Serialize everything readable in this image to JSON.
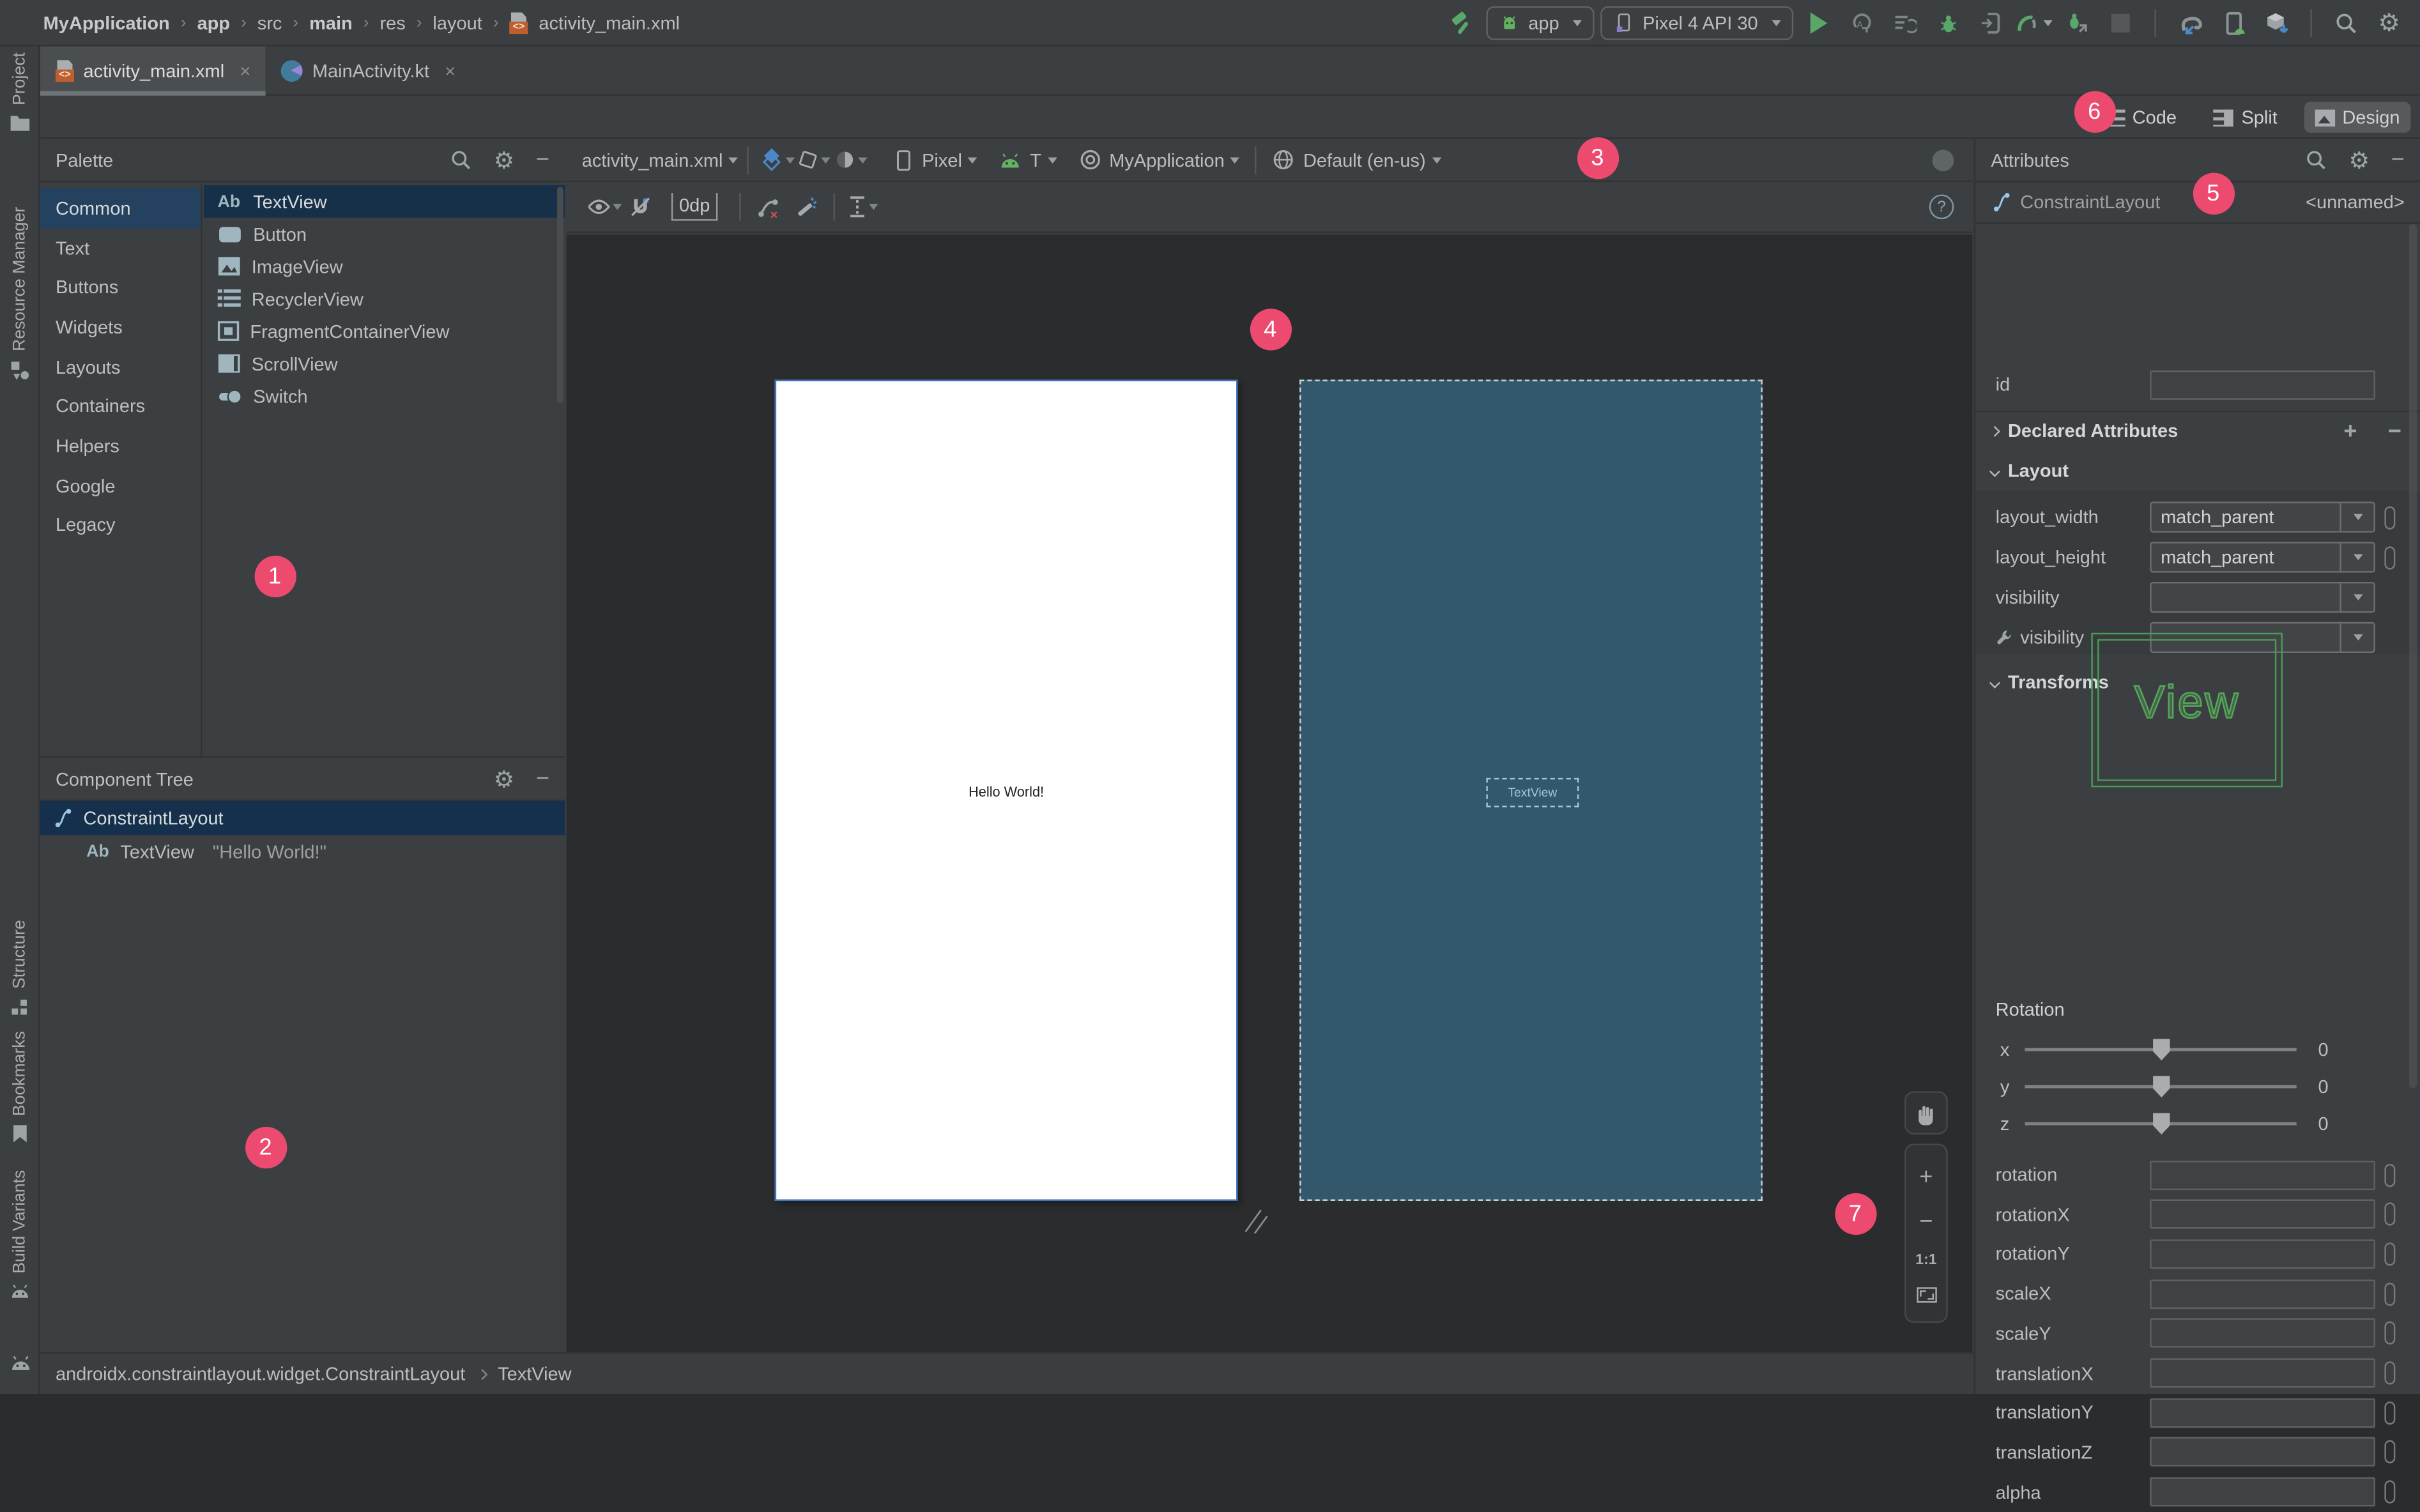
{
  "main_toolbar": {
    "breadcrumb": [
      {
        "label": "MyApplication",
        "bold": true
      },
      {
        "label": "app",
        "bold": true
      },
      {
        "label": "src",
        "bold": false
      },
      {
        "label": "main",
        "bold": true
      },
      {
        "label": "res",
        "bold": false
      },
      {
        "label": "layout",
        "bold": false
      },
      {
        "label": "activity_main.xml",
        "bold": false
      }
    ],
    "run_config": "app",
    "device": "Pixel 4 API 30"
  },
  "tabs": [
    {
      "label": "activity_main.xml",
      "active": true
    },
    {
      "label": "MainActivity.kt",
      "active": false
    }
  ],
  "editor_modes": {
    "code": "Code",
    "split": "Split",
    "design": "Design",
    "active": "Design"
  },
  "tool_strip": {
    "project": "Project",
    "resource_manager": "Resource Manager",
    "structure": "Structure",
    "bookmarks": "Bookmarks",
    "build_variants": "Build Variants"
  },
  "palette": {
    "title": "Palette",
    "categories": [
      "Common",
      "Text",
      "Buttons",
      "Widgets",
      "Layouts",
      "Containers",
      "Helpers",
      "Google",
      "Legacy"
    ],
    "selected_category": "Common",
    "items": [
      "TextView",
      "Button",
      "ImageView",
      "RecyclerView",
      "FragmentContainerView",
      "ScrollView",
      "Switch"
    ],
    "selected_item": "TextView"
  },
  "component_tree": {
    "title": "Component Tree",
    "root": "ConstraintLayout",
    "child": "TextView",
    "child_text": "\"Hello World!\""
  },
  "design_toolbar": {
    "file": "activity_main.xml",
    "margin": "0dp",
    "device": "Pixel",
    "api": "T",
    "theme": "MyApplication",
    "locale": "Default (en-us)"
  },
  "canvas": {
    "design_text": "Hello World!",
    "blueprint_label": "TextView"
  },
  "zoom_controls": {
    "zoom_in": "+",
    "zoom_out": "−",
    "actual": "1:1"
  },
  "attributes": {
    "title": "Attributes",
    "component": "ConstraintLayout",
    "instance": "<unnamed>",
    "id_label": "id",
    "id_value": "",
    "sections": {
      "declared": "Declared Attributes",
      "layout": "Layout",
      "transforms": "Transforms"
    },
    "layout_rows": [
      {
        "label": "layout_width",
        "value": "match_parent"
      },
      {
        "label": "layout_height",
        "value": "match_parent"
      },
      {
        "label": "visibility",
        "value": ""
      },
      {
        "label": "visibility",
        "value": "",
        "tools": true
      }
    ],
    "view_preview": "View",
    "rotation": {
      "label": "Rotation",
      "axes": [
        {
          "axis": "x",
          "value": "0"
        },
        {
          "axis": "y",
          "value": "0"
        },
        {
          "axis": "z",
          "value": "0"
        }
      ]
    },
    "transform_fields": [
      "rotation",
      "rotationX",
      "rotationY",
      "scaleX",
      "scaleY",
      "translationX",
      "translationY",
      "translationZ",
      "alpha"
    ]
  },
  "status_bar": {
    "path": "androidx.constraintlayout.widget.ConstraintLayout",
    "node": "TextView"
  },
  "badges": [
    "1",
    "2",
    "3",
    "4",
    "5",
    "6",
    "7"
  ],
  "icons": {
    "gear": "⚙",
    "minimize": "−",
    "close": "×",
    "plus": "+",
    "minus": "−",
    "question": "?",
    "ab": "Ab",
    "xml": "<>",
    "cross": "×"
  },
  "colors": {
    "badge": "#ed4a70",
    "blueprint_bg": "#33586b",
    "selection": "#16304a",
    "accent_green": "#499c54",
    "selected_border_blue": "#3d74b8",
    "panel_bg": "#3c3f41",
    "canvas_bg": "#2a2c2e"
  }
}
